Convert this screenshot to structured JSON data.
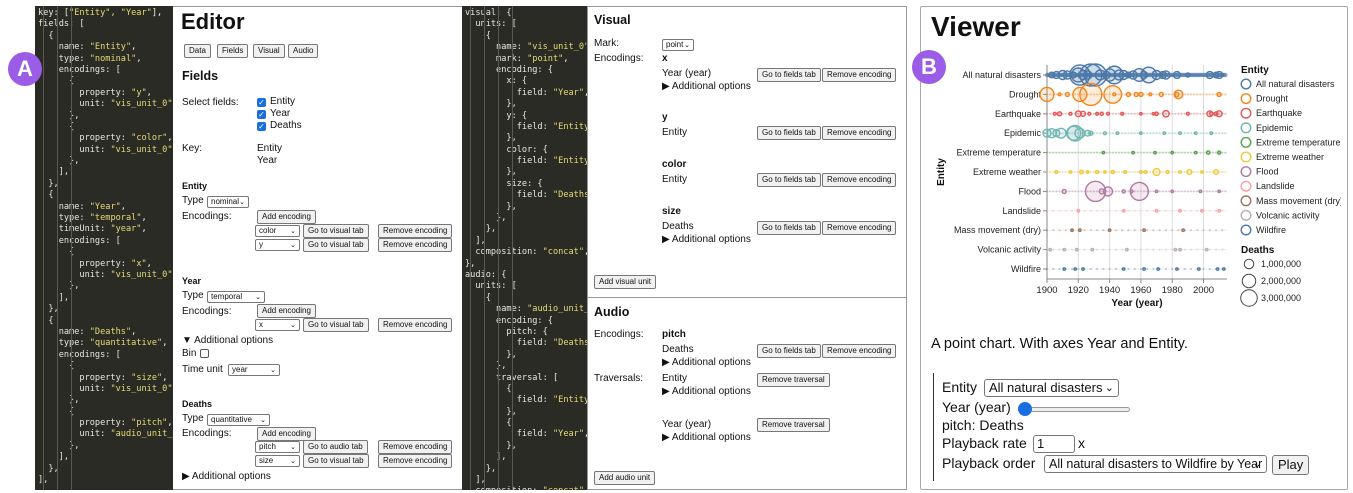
{
  "badges": {
    "a": "A",
    "b": "B"
  },
  "code_left": [
    [
      "key: [",
      "\"Entity\", \"Year\"",
      "],"
    ],
    [
      "fields: [",
      "",
      ""
    ],
    [
      "  {",
      "",
      ""
    ],
    [
      "    name: ",
      "\"Entity\"",
      ","
    ],
    [
      "    type: ",
      "\"nominal\"",
      ","
    ],
    [
      "    encodings: [",
      "",
      ""
    ],
    [
      "      {",
      "",
      ""
    ],
    [
      "        property: ",
      "\"y\"",
      ","
    ],
    [
      "        unit: ",
      "\"vis_unit_0\"",
      ","
    ],
    [
      "      },",
      "",
      ""
    ],
    [
      "      {",
      "",
      ""
    ],
    [
      "        property: ",
      "\"color\"",
      ","
    ],
    [
      "        unit: ",
      "\"vis_unit_0\"",
      ","
    ],
    [
      "      },",
      "",
      ""
    ],
    [
      "    ],",
      "",
      ""
    ],
    [
      "  },",
      "",
      ""
    ],
    [
      "  {",
      "",
      ""
    ],
    [
      "    name: ",
      "\"Year\"",
      ","
    ],
    [
      "    type: ",
      "\"temporal\"",
      ","
    ],
    [
      "    timeUnit: ",
      "\"year\"",
      ","
    ],
    [
      "    encodings: [",
      "",
      ""
    ],
    [
      "      {",
      "",
      ""
    ],
    [
      "        property: ",
      "\"x\"",
      ","
    ],
    [
      "        unit: ",
      "\"vis_unit_0\"",
      ","
    ],
    [
      "      },",
      "",
      ""
    ],
    [
      "    ],",
      "",
      ""
    ],
    [
      "  },",
      "",
      ""
    ],
    [
      "  {",
      "",
      ""
    ],
    [
      "    name: ",
      "\"Deaths\"",
      ","
    ],
    [
      "    type: ",
      "\"quantitative\"",
      ","
    ],
    [
      "    encodings: [",
      "",
      ""
    ],
    [
      "      {",
      "",
      ""
    ],
    [
      "        property: ",
      "\"size\"",
      ","
    ],
    [
      "        unit: ",
      "\"vis_unit_0\"",
      ","
    ],
    [
      "      },",
      "",
      ""
    ],
    [
      "      {",
      "",
      ""
    ],
    [
      "        property: ",
      "\"pitch\"",
      ","
    ],
    [
      "        unit: ",
      "\"audio_unit_0\"",
      ","
    ],
    [
      "      },",
      "",
      ""
    ],
    [
      "    ],",
      "",
      ""
    ],
    [
      "  },",
      "",
      ""
    ],
    [
      "],",
      "",
      ""
    ]
  ],
  "code_right": [
    [
      "visual: {",
      "",
      ""
    ],
    [
      "  units: [",
      "",
      ""
    ],
    [
      "    {",
      "",
      ""
    ],
    [
      "      name: ",
      "\"vis_unit_0\"",
      ","
    ],
    [
      "      mark: ",
      "\"point\"",
      ","
    ],
    [
      "      encoding: {",
      "",
      ""
    ],
    [
      "        x: {",
      "",
      ""
    ],
    [
      "          field: ",
      "\"Year\"",
      ","
    ],
    [
      "        },",
      "",
      ""
    ],
    [
      "        y: {",
      "",
      ""
    ],
    [
      "          field: ",
      "\"Entity\"",
      ","
    ],
    [
      "        },",
      "",
      ""
    ],
    [
      "        color: {",
      "",
      ""
    ],
    [
      "          field: ",
      "\"Entity\"",
      ","
    ],
    [
      "        },",
      "",
      ""
    ],
    [
      "        size: {",
      "",
      ""
    ],
    [
      "          field: ",
      "\"Deaths\"",
      ","
    ],
    [
      "        },",
      "",
      ""
    ],
    [
      "      },",
      "",
      ""
    ],
    [
      "    },",
      "",
      ""
    ],
    [
      "  ],",
      "",
      ""
    ],
    [
      "  composition: ",
      "\"concat\"",
      ","
    ],
    [
      "},",
      "",
      ""
    ],
    [
      "audio: {",
      "",
      ""
    ],
    [
      "  units: [",
      "",
      ""
    ],
    [
      "    {",
      "",
      ""
    ],
    [
      "      name: ",
      "\"audio_unit_0\"",
      ","
    ],
    [
      "      encoding: {",
      "",
      ""
    ],
    [
      "        pitch: {",
      "",
      ""
    ],
    [
      "          field: ",
      "\"Deaths\"",
      ","
    ],
    [
      "        },",
      "",
      ""
    ],
    [
      "      },",
      "",
      ""
    ],
    [
      "      traversal: [",
      "",
      ""
    ],
    [
      "        {",
      "",
      ""
    ],
    [
      "          field: ",
      "\"Entity\"",
      ","
    ],
    [
      "        },",
      "",
      ""
    ],
    [
      "        {",
      "",
      ""
    ],
    [
      "          field: ",
      "\"Year\"",
      ","
    ],
    [
      "        },",
      "",
      ""
    ],
    [
      "      ],",
      "",
      ""
    ],
    [
      "    },",
      "",
      ""
    ],
    [
      "  ],",
      "",
      ""
    ],
    [
      "  composition: ",
      "\"concat\"",
      ","
    ],
    [
      "},",
      "",
      ""
    ]
  ],
  "editor": {
    "title": "Editor",
    "tabs": [
      "Data",
      "Fields",
      "Visual",
      "Audio"
    ],
    "fields_heading": "Fields",
    "select_fields_label": "Select fields:",
    "select_fields": [
      "Entity",
      "Year",
      "Deaths"
    ],
    "key_label": "Key:",
    "key_values": [
      "Entity",
      "Year"
    ],
    "type_label": "Type",
    "encodings_label": "Encodings:",
    "add_encoding": "Add encoding",
    "remove_encoding": "Remove encoding",
    "go_visual": "Go to visual tab",
    "go_audio": "Go to audio tab",
    "additional_options_open": "▼ Additional options",
    "additional_options": "▶ Additional options",
    "bin_label": "Bin",
    "time_unit_label": "Time unit",
    "entity": {
      "heading": "Entity",
      "type": "nominal",
      "encodings": [
        "color",
        "y"
      ]
    },
    "year": {
      "heading": "Year",
      "type": "temporal",
      "encodings": [
        "x"
      ],
      "time_unit": "year"
    },
    "deaths": {
      "heading": "Deaths",
      "type": "quantitative",
      "encodings": [
        "pitch",
        "size"
      ]
    }
  },
  "visual": {
    "heading": "Visual",
    "mark_label": "Mark:",
    "mark_value": "point",
    "encodings_label": "Encodings:",
    "channels": [
      {
        "channel": "x",
        "field": "Year (year)",
        "options": "▶ Additional options"
      },
      {
        "channel": "y",
        "field": "Entity",
        "options": ""
      },
      {
        "channel": "color",
        "field": "Entity",
        "options": ""
      },
      {
        "channel": "size",
        "field": "Deaths",
        "options": "▶ Additional options"
      }
    ],
    "go_fields": "Go to fields tab",
    "remove_encoding": "Remove encoding",
    "add_unit": "Add visual unit"
  },
  "audio": {
    "heading": "Audio",
    "encodings_label": "Encodings:",
    "pitch_channel": "pitch",
    "pitch_field": "Deaths",
    "options": "▶ Additional options",
    "traversals_label": "Traversals:",
    "traversals": [
      "Entity",
      "Year (year)"
    ],
    "go_fields": "Go to fields tab",
    "remove_encoding": "Remove encoding",
    "remove_traversal": "Remove traversal",
    "add_unit": "Add audio unit"
  },
  "viewer": {
    "title": "Viewer",
    "description": "A point chart. With axes Year and Entity.",
    "entity_label": "Entity",
    "entity_value": "All natural disasters",
    "year_label": "Year (year)",
    "year_slider_fraction": 0.0,
    "pitch_text": "pitch: Deaths",
    "rate_label": "Playback rate",
    "rate_value": "1",
    "rate_unit": "x",
    "order_label": "Playback order",
    "order_value": "All natural disasters to Wildfire by Year",
    "play": "Play"
  },
  "chart_data": {
    "type": "scatter",
    "title": "",
    "xlabel": "Year (year)",
    "ylabel": "Entity",
    "xlim": [
      1900,
      2015
    ],
    "x_ticks": [
      "1900",
      "1920",
      "1940",
      "1960",
      "1980",
      "2000"
    ],
    "x_tick_values": [
      1900,
      1920,
      1940,
      1960,
      1980,
      2000
    ],
    "categories": [
      "All natural disasters",
      "Drought",
      "Earthquake",
      "Epidemic",
      "Extreme temperature",
      "Extreme weather",
      "Flood",
      "Landslide",
      "Mass movement (dry)",
      "Volcanic activity",
      "Wildfire"
    ],
    "colors": [
      "#4c78a8",
      "#f58518",
      "#e45756",
      "#72b7b2",
      "#54a24b",
      "#eeca3b",
      "#b279a2",
      "#ff9da6",
      "#9d755d",
      "#bab0ac",
      "#4c78a8"
    ],
    "legend_color_title": "Entity",
    "legend_size_title": "Deaths",
    "size_legend": [
      "1,000,000",
      "2,000,000",
      "3,000,000"
    ],
    "size_values": [
      1000000,
      2000000,
      3000000
    ],
    "grid": true,
    "legend_position": "right",
    "series": [
      {
        "name": "All natural disasters",
        "points": [
          [
            1903,
            200000
          ],
          [
            1906,
            300000
          ],
          [
            1910,
            500000
          ],
          [
            1913,
            400000
          ],
          [
            1917,
            200000
          ],
          [
            1920,
            1200000
          ],
          [
            1921,
            2500000
          ],
          [
            1923,
            500000
          ],
          [
            1926,
            400000
          ],
          [
            1928,
            3000000
          ],
          [
            1931,
            3000000
          ],
          [
            1934,
            600000
          ],
          [
            1938,
            300000
          ],
          [
            1940,
            900000
          ],
          [
            1943,
            1900000
          ],
          [
            1946,
            600000
          ],
          [
            1949,
            500000
          ],
          [
            1952,
            200000
          ],
          [
            1955,
            400000
          ],
          [
            1959,
            1000000
          ],
          [
            1962,
            300000
          ],
          [
            1965,
            1500000
          ],
          [
            1970,
            500000
          ],
          [
            1974,
            300000
          ],
          [
            1976,
            400000
          ],
          [
            1983,
            300000
          ],
          [
            1990,
            100000
          ],
          [
            2004,
            300000
          ],
          [
            2008,
            200000
          ],
          [
            2010,
            300000
          ],
          [
            2012,
            50000
          ]
        ]
      },
      {
        "name": "Drought",
        "points": [
          [
            1900,
            1200000
          ],
          [
            1908,
            50000
          ],
          [
            1913,
            100000
          ],
          [
            1921,
            1200000
          ],
          [
            1928,
            3000000
          ],
          [
            1942,
            1900000
          ],
          [
            1943,
            50000
          ],
          [
            1952,
            100000
          ],
          [
            1957,
            100000
          ],
          [
            1960,
            100000
          ],
          [
            1966,
            50000
          ],
          [
            1973,
            100000
          ],
          [
            1983,
            100000
          ],
          [
            1984,
            450000
          ],
          [
            2010,
            100000
          ]
        ]
      },
      {
        "name": "Earthquake",
        "points": [
          [
            1905,
            50000
          ],
          [
            1908,
            100000
          ],
          [
            1915,
            50000
          ],
          [
            1920,
            200000
          ],
          [
            1923,
            150000
          ],
          [
            1927,
            50000
          ],
          [
            1932,
            50000
          ],
          [
            1935,
            60000
          ],
          [
            1939,
            50000
          ],
          [
            1948,
            50000
          ],
          [
            1960,
            30000
          ],
          [
            1968,
            30000
          ],
          [
            1970,
            70000
          ],
          [
            1976,
            250000
          ],
          [
            1990,
            50000
          ],
          [
            2004,
            200000
          ],
          [
            2005,
            80000
          ],
          [
            2008,
            90000
          ],
          [
            2010,
            220000
          ]
        ]
      },
      {
        "name": "Epidemic",
        "points": [
          [
            1900,
            400000
          ],
          [
            1903,
            500000
          ],
          [
            1906,
            300000
          ],
          [
            1909,
            600000
          ],
          [
            1917,
            1200000
          ],
          [
            1918,
            1500000
          ],
          [
            1921,
            600000
          ],
          [
            1926,
            200000
          ],
          [
            1928,
            100000
          ],
          [
            1937,
            50000
          ],
          [
            1945,
            30000
          ],
          [
            1960,
            20000
          ],
          [
            1975,
            20000
          ],
          [
            1985,
            20000
          ],
          [
            1995,
            20000
          ],
          [
            2005,
            20000
          ]
        ]
      },
      {
        "name": "Extreme temperature",
        "points": [
          [
            1936,
            30000
          ],
          [
            1955,
            20000
          ],
          [
            1969,
            20000
          ],
          [
            1980,
            30000
          ],
          [
            1995,
            30000
          ],
          [
            2003,
            70000
          ],
          [
            2010,
            60000
          ]
        ]
      },
      {
        "name": "Extreme weather",
        "points": [
          [
            1906,
            50000
          ],
          [
            1915,
            30000
          ],
          [
            1922,
            80000
          ],
          [
            1926,
            30000
          ],
          [
            1932,
            60000
          ],
          [
            1937,
            30000
          ],
          [
            1942,
            60000
          ],
          [
            1950,
            40000
          ],
          [
            1960,
            40000
          ],
          [
            1963,
            50000
          ],
          [
            1970,
            300000
          ],
          [
            1977,
            50000
          ],
          [
            1985,
            30000
          ],
          [
            1991,
            150000
          ],
          [
            1999,
            30000
          ],
          [
            2008,
            140000
          ]
        ]
      },
      {
        "name": "Flood",
        "points": [
          [
            1911,
            100000
          ],
          [
            1931,
            2500000
          ],
          [
            1935,
            150000
          ],
          [
            1939,
            500000
          ],
          [
            1949,
            60000
          ],
          [
            1954,
            50000
          ],
          [
            1959,
            2000000
          ],
          [
            1970,
            30000
          ],
          [
            1980,
            20000
          ],
          [
            1998,
            30000
          ],
          [
            2010,
            20000
          ]
        ]
      },
      {
        "name": "Landslide",
        "points": [
          [
            1920,
            20000
          ],
          [
            1949,
            10000
          ],
          [
            1970,
            15000
          ],
          [
            1985,
            20000
          ],
          [
            1999,
            15000
          ],
          [
            2010,
            10000
          ]
        ]
      },
      {
        "name": "Mass movement (dry)",
        "points": [
          [
            1916,
            10000
          ],
          [
            1921,
            8000
          ],
          [
            1940,
            5000
          ],
          [
            1962,
            6000
          ],
          [
            1987,
            5000
          ]
        ]
      },
      {
        "name": "Volcanic activity",
        "points": [
          [
            1902,
            30000
          ],
          [
            1911,
            5000
          ],
          [
            1919,
            8000
          ],
          [
            1929,
            5000
          ],
          [
            1951,
            5000
          ],
          [
            1982,
            8000
          ],
          [
            1985,
            25000
          ],
          [
            2002,
            5000
          ]
        ]
      },
      {
        "name": "Wildfire",
        "points": [
          [
            1911,
            3000
          ],
          [
            1918,
            4000
          ],
          [
            1923,
            3000
          ],
          [
            1949,
            2000
          ],
          [
            1962,
            3000
          ],
          [
            1971,
            3000
          ],
          [
            1983,
            3000
          ],
          [
            1997,
            3000
          ],
          [
            2009,
            3000
          ],
          [
            2013,
            3000
          ]
        ]
      }
    ]
  }
}
